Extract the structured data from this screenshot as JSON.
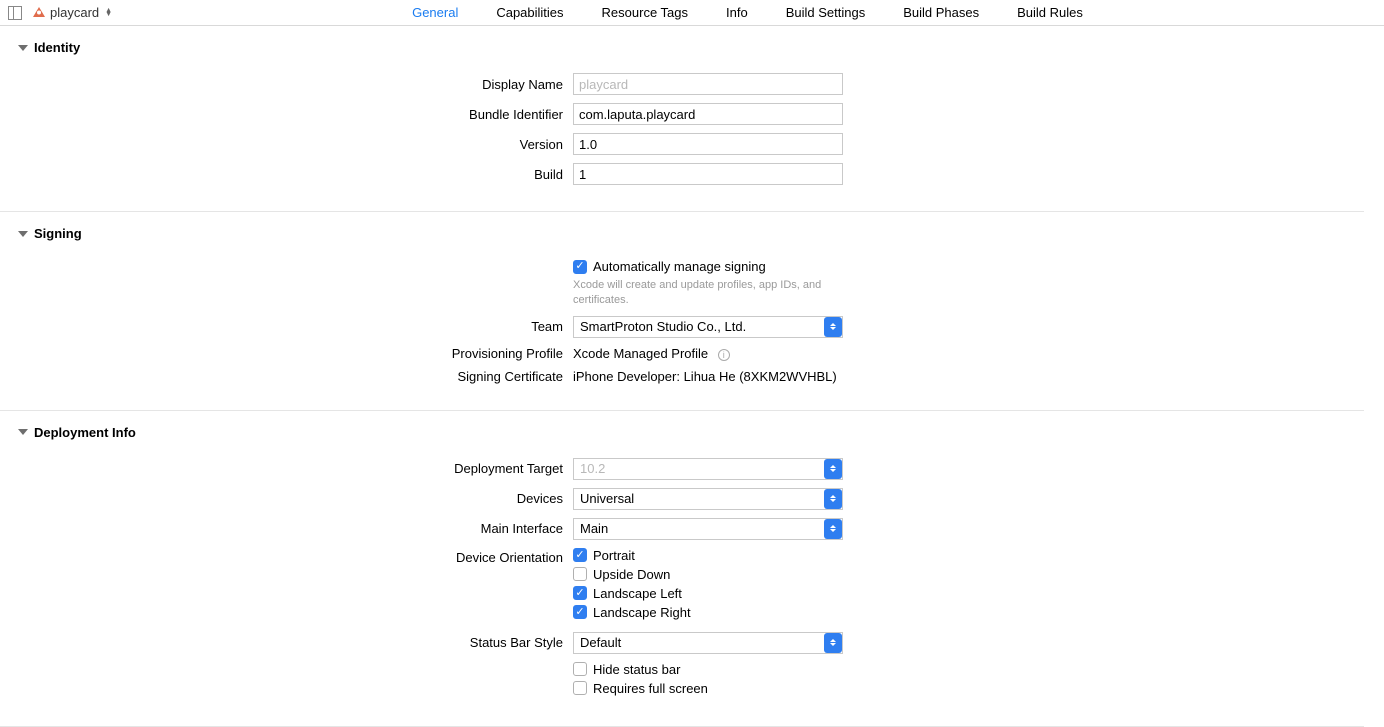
{
  "header": {
    "target_name": "playcard",
    "tabs": [
      "General",
      "Capabilities",
      "Resource Tags",
      "Info",
      "Build Settings",
      "Build Phases",
      "Build Rules"
    ],
    "active_tab": 0
  },
  "sections": {
    "identity": {
      "title": "Identity",
      "display_name_label": "Display Name",
      "display_name_placeholder": "playcard",
      "display_name_value": "",
      "bundle_id_label": "Bundle Identifier",
      "bundle_id_value": "com.laputa.playcard",
      "version_label": "Version",
      "version_value": "1.0",
      "build_label": "Build",
      "build_value": "1"
    },
    "signing": {
      "title": "Signing",
      "auto_label": "Automatically manage signing",
      "auto_checked": true,
      "auto_hint": "Xcode will create and update profiles, app IDs, and certificates.",
      "team_label": "Team",
      "team_value": "SmartProton Studio Co., Ltd.",
      "profile_label": "Provisioning Profile",
      "profile_value": "Xcode Managed Profile",
      "cert_label": "Signing Certificate",
      "cert_value": "iPhone Developer: Lihua He (8XKM2WVHBL)"
    },
    "deployment": {
      "title": "Deployment Info",
      "target_label": "Deployment Target",
      "target_placeholder": "10.2",
      "devices_label": "Devices",
      "devices_value": "Universal",
      "main_interface_label": "Main Interface",
      "main_interface_value": "Main",
      "orientation_label": "Device Orientation",
      "orientations": [
        {
          "label": "Portrait",
          "checked": true
        },
        {
          "label": "Upside Down",
          "checked": false
        },
        {
          "label": "Landscape Left",
          "checked": true
        },
        {
          "label": "Landscape Right",
          "checked": true
        }
      ],
      "status_bar_label": "Status Bar Style",
      "status_bar_value": "Default",
      "hide_status_label": "Hide status bar",
      "hide_status_checked": false,
      "requires_full_label": "Requires full screen",
      "requires_full_checked": false
    }
  }
}
